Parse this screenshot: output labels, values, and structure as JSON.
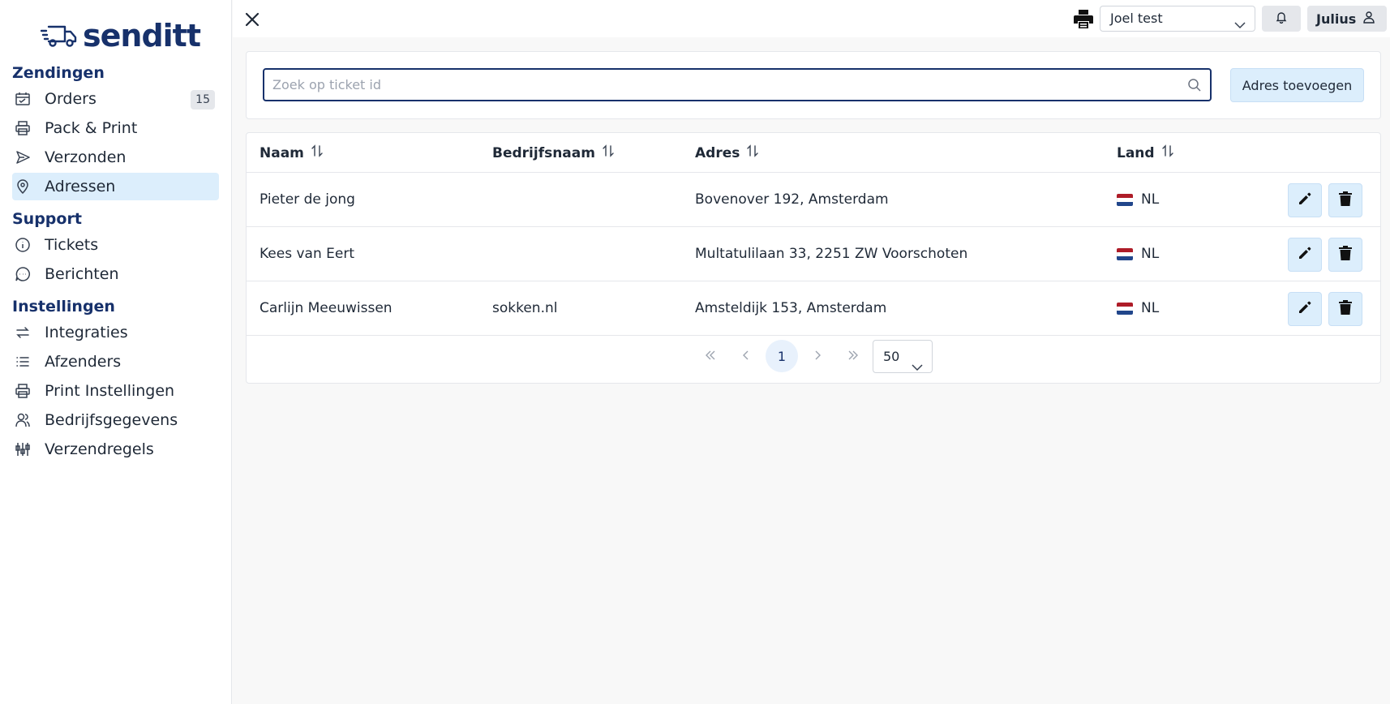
{
  "brand": {
    "name": "senditt"
  },
  "sidebar": {
    "sections": [
      {
        "title": "Zendingen"
      },
      {
        "title": "Support"
      },
      {
        "title": "Instellingen"
      }
    ],
    "items": [
      {
        "label": "Orders",
        "icon": "calendar-icon",
        "badge": "15"
      },
      {
        "label": "Pack & Print",
        "icon": "printer-icon"
      },
      {
        "label": "Verzonden",
        "icon": "send-icon"
      },
      {
        "label": "Adressen",
        "icon": "map-pin-icon",
        "active": true
      },
      {
        "label": "Tickets",
        "icon": "info-icon"
      },
      {
        "label": "Berichten",
        "icon": "chat-icon"
      },
      {
        "label": "Integraties",
        "icon": "arrows-icon"
      },
      {
        "label": "Afzenders",
        "icon": "list-icon"
      },
      {
        "label": "Print Instellingen",
        "icon": "printer-icon"
      },
      {
        "label": "Bedrijfsgegevens",
        "icon": "users-icon"
      },
      {
        "label": "Verzendregels",
        "icon": "sliders-icon"
      }
    ]
  },
  "topbar": {
    "printer_select": "Joel test",
    "user_name": "Julius"
  },
  "search": {
    "placeholder": "Zoek op ticket id",
    "value": "",
    "add_button": "Adres toevoegen"
  },
  "table": {
    "columns": [
      "Naam",
      "Bedrijfsnaam",
      "Adres",
      "Land"
    ],
    "rows": [
      {
        "naam": "Pieter de jong",
        "bedrijfsnaam": "",
        "adres": "Bovenover 192, Amsterdam",
        "land": "NL"
      },
      {
        "naam": "Kees van Eert",
        "bedrijfsnaam": "",
        "adres": "Multatulilaan 33, 2251 ZW Voorschoten",
        "land": "NL"
      },
      {
        "naam": "Carlijn Meeuwissen",
        "bedrijfsnaam": "sokken.nl",
        "adres": "Amsteldijk 153, Amsterdam",
        "land": "NL"
      }
    ]
  },
  "pagination": {
    "current_page": "1",
    "page_size": "50"
  },
  "colors": {
    "brand": "#17316b",
    "active_bg": "#dceefc",
    "flag_red": "#ae1c28",
    "flag_white": "#ffffff",
    "flag_blue": "#21468b"
  }
}
